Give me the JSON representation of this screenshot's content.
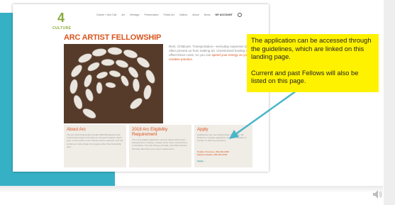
{
  "site": {
    "logo": {
      "mark": "4",
      "text": "CULTURE"
    },
    "nav": [
      "Grants + Arts Call",
      "Art",
      "Heritage",
      "Preservation",
      "Public Art",
      "Gallery",
      "About",
      "News",
      "MY ACCOUNT"
    ],
    "page_title": "ARC ARTIST FELLOWSHIP",
    "intro_text": "Rent. Childcare. Transportation—everyday expenses too often prevent us from making art. Unrestricted funding can offset these costs, so you can",
    "intro_highlight": "spend your energy on your creative practice."
  },
  "cards": [
    {
      "title": "About Arc",
      "body": "The Arc Artist Fellowship provides $50,000 awards and professional support through the 18-week initiative. Each year, a new cohort of Arc Fellows will be selected, and will continue to help shape the program after their fellowship year.",
      "link": "",
      "more": ""
    },
    {
      "title": "2018 Arc Eligibility Requirement",
      "body": "The most eligible applicants must be artists with proven development, curiosity, creative work, and a commitment to discipline. The will change annually, and 2018 Fellows will help determine next year's requirement.",
      "link": "",
      "more": ""
    },
    {
      "title": "Apply",
      "body": "Applications are due Wednesday, November 28. Read the complete guidelines and don't hesitate to contact us with any questions.",
      "link": "Heather Pontonio, 206-263-0000\nMelissa Newbill, 206-263-0000",
      "more": "Apply →"
    }
  ],
  "callout": {
    "line1": "The application can be accessed through the guidelines, which are linked on this landing page.",
    "line2": "Current and past Fellows will also be listed on this page."
  },
  "colors": {
    "accent_orange": "#d9541e",
    "teal": "#36b0c5",
    "callout_yellow": "#fff200",
    "logo_green": "#8aa93a"
  }
}
